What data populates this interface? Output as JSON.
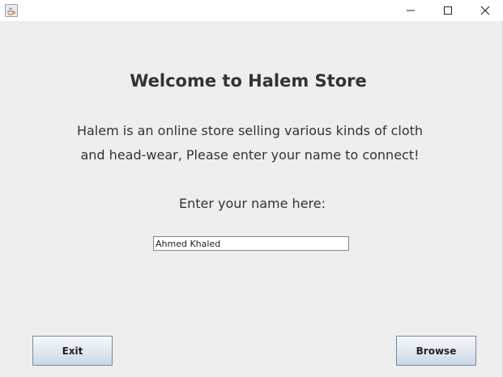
{
  "window": {
    "app_icon": "java-coffee-cup-icon",
    "controls": {
      "minimize_icon": "minimize-icon",
      "maximize_icon": "maximize-icon",
      "close_icon": "close-icon"
    }
  },
  "main": {
    "heading": "Welcome to Halem Store",
    "description_line1": "Halem is an online store selling various kinds of cloth",
    "description_line2": "and head-wear, Please enter your name to connect!",
    "name_prompt": "Enter your name here:",
    "name_input_value": "Ahmed Khaled"
  },
  "buttons": {
    "exit_label": "Exit",
    "browse_label": "Browse"
  },
  "colors": {
    "background": "#eeeeee",
    "text": "#333333",
    "button_border": "#7a8a99"
  }
}
